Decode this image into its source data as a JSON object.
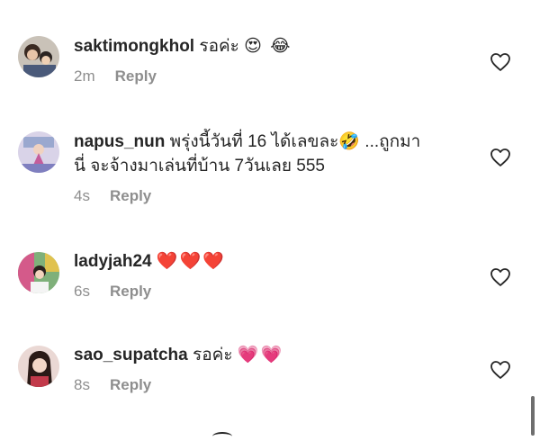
{
  "comments": [
    {
      "username": "saktimongkhol",
      "text": "รอค่ะ",
      "emojis": "😍 😂",
      "continuation": "",
      "time": "2m",
      "reply_label": "Reply",
      "avatar_icon": "user-avatar-icon"
    },
    {
      "username": "napus_nun",
      "text": "พรุ่งนี้วันที่ 16 ได้เลขละ🤣 ...ถูกมา",
      "emojis": "",
      "continuation": "นี่ จะจ้างมาเล่นที่บ้าน 7วันเลย 555",
      "time": "4s",
      "reply_label": "Reply",
      "avatar_icon": "user-avatar-icon"
    },
    {
      "username": "ladyjah24",
      "text": "",
      "emojis": "❤️❤️❤️",
      "continuation": "",
      "time": "6s",
      "reply_label": "Reply",
      "avatar_icon": "user-avatar-icon"
    },
    {
      "username": "sao_supatcha",
      "text": "รอค่ะ",
      "emojis": "💗💗",
      "continuation": "",
      "time": "8s",
      "reply_label": "Reply",
      "avatar_icon": "user-avatar-icon"
    }
  ],
  "like_icon": "heart-outline-icon",
  "colors": {
    "text": "#262626",
    "meta": "#8e8e8e",
    "background": "#ffffff"
  }
}
